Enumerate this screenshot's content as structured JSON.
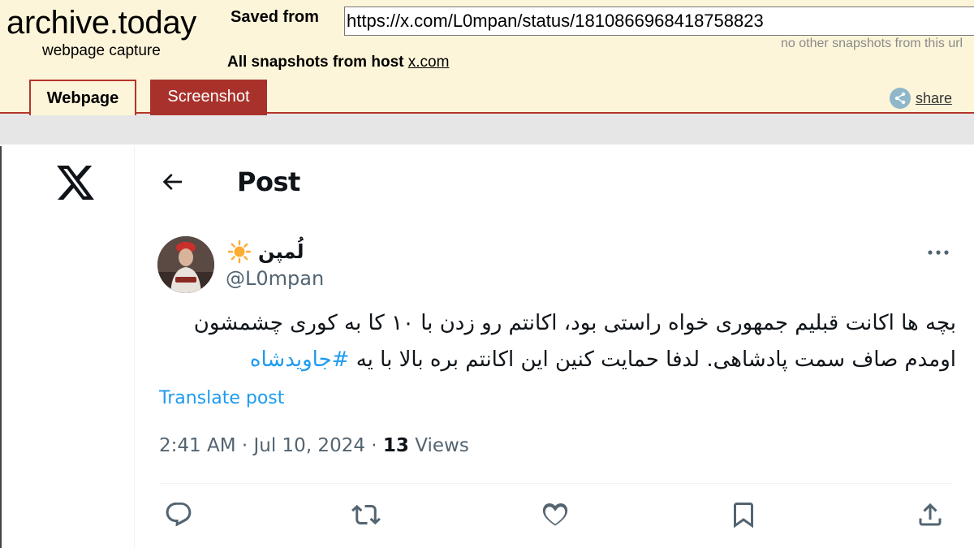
{
  "archive": {
    "brand_title": "archive.today",
    "brand_subtitle": "webpage capture",
    "saved_from_label": "Saved from",
    "url": "https://x.com/L0mpan/status/1810866968418758823",
    "no_snapshots": "no other snapshots from this url",
    "all_snapshots_label": "All snapshots  from host ",
    "host": "x.com",
    "tabs": [
      {
        "label": "Webpage",
        "active": true
      },
      {
        "label": "Screenshot",
        "active": false
      }
    ],
    "share_label": "share",
    "colors": {
      "bar_bg": "#fdf5d9",
      "tab_red": "#a8322b"
    }
  },
  "post": {
    "page_title": "Post",
    "author": {
      "display_name": "لُمپن",
      "handle": "@L0mpan",
      "name_emoji": "sun-icon"
    },
    "text_line1": "بچه ها اکانت قبلیم جمهوری خواه راستی بود، اکانتم رو زدن با ۱۰ کا به کوری چشمشون",
    "text_line2": "اومدم صاف سمت پادشاهی. لدفا حمایت کنین این اکانتم بره بالا با یه ",
    "hashtag": "#جاویدشاه",
    "translate_label": "Translate post",
    "time": "2:41 AM",
    "date": "Jul 10, 2024",
    "views_count": "13",
    "views_label": "Views",
    "separator": "·",
    "colors": {
      "link": "#1d9bf0",
      "text": "#0f1419",
      "muted": "#536471"
    }
  }
}
